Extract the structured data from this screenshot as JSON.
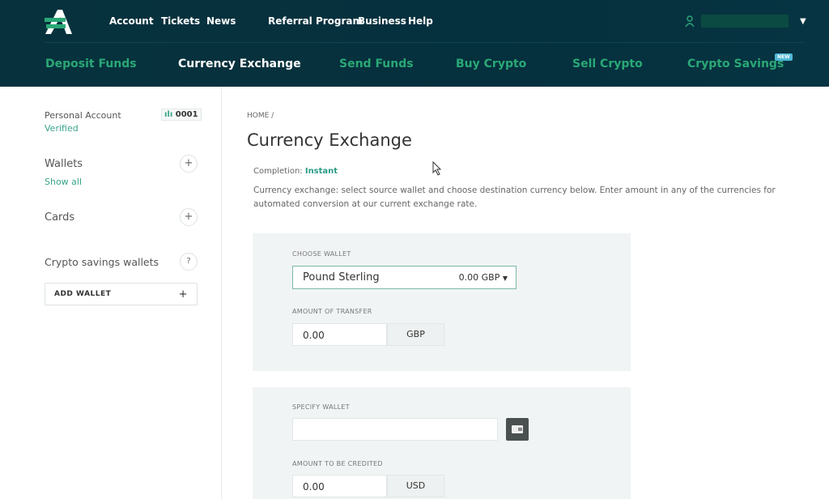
{
  "header": {
    "top_links": [
      "Account",
      "Tickets",
      "News",
      "Referral Program",
      "Business",
      "Help"
    ],
    "nav": [
      "Deposit Funds",
      "Currency Exchange",
      "Send Funds",
      "Buy Crypto",
      "Sell Crypto",
      "Crypto Savings"
    ],
    "active_nav": "Currency Exchange",
    "new_badge": "NEW",
    "user_icon": "user-icon",
    "accent": "#2aa876"
  },
  "sidebar": {
    "account_type": "Personal Account",
    "account_status": "Verified",
    "account_number": "0001",
    "wallets": "Wallets",
    "show_all": "Show all",
    "cards": "Cards",
    "crypto_savings": "Crypto savings wallets",
    "help": "?",
    "add_wallet": "ADD WALLET",
    "plus": "+"
  },
  "main": {
    "breadcrumb": "HOME /",
    "title": "Currency Exchange",
    "completion_label": "Completion:",
    "completion_value": "Instant",
    "description": "Currency exchange: select source wallet and choose destination currency below. Enter amount in any of the currencies for automated conversion at our current exchange rate.",
    "source": {
      "choose_wallet_label": "CHOOSE WALLET",
      "wallet_name": "Pound Sterling",
      "wallet_balance": "0.00 GBP",
      "amount_label": "AMOUNT OF TRANSFER",
      "amount": "0.00",
      "currency": "GBP"
    },
    "dest": {
      "specify_wallet_label": "SPECIFY WALLET",
      "wallet_value": "",
      "amount_label": "AMOUNT TO BE CREDITED",
      "amount": "0.00",
      "currency": "USD"
    }
  }
}
